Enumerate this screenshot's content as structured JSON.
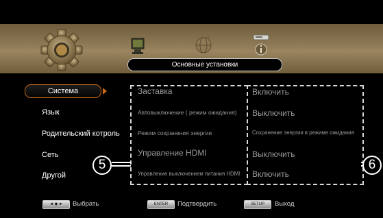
{
  "header": {
    "title": "Основные установки"
  },
  "categories": [
    {
      "label": "Система"
    },
    {
      "label": "Язык"
    },
    {
      "label": "Родительский котроль"
    },
    {
      "label": "Сеть"
    },
    {
      "label": "Другой"
    }
  ],
  "options": [
    {
      "label": "Заставка"
    },
    {
      "label": "Автовыключение ( режим ожидания)"
    },
    {
      "label": "Режим сохранения энергии"
    },
    {
      "label": "Управление HDMI"
    },
    {
      "label": "Управление выключением питания HDMI"
    }
  ],
  "values": [
    {
      "label": "Включить"
    },
    {
      "label": "Выключить"
    },
    {
      "label": "Сохранение энергии в режиме ожидания"
    },
    {
      "label": "Выключить"
    },
    {
      "label": "Включить"
    }
  ],
  "callouts": {
    "left": "5",
    "right": "6"
  },
  "footer": {
    "navigate_key": "◄ ◆ ►",
    "navigate_label": "Выбрать",
    "enter_key": "ENTER",
    "enter_label": "Подтвердить",
    "setup_key": "SETUP",
    "setup_label": "Выход"
  },
  "colors": {
    "accent": "#c46a18",
    "band": "#8c7854",
    "text_dim": "#9a9a9a"
  }
}
